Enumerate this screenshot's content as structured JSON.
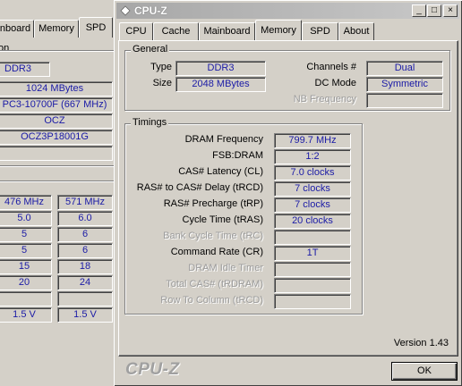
{
  "background_window": {
    "tabs": [
      "nboard",
      "Memory",
      "SPD"
    ],
    "active_tab": "SPD",
    "section_label": "on",
    "module_fields": [
      "DDR3",
      "1024 MBytes",
      "PC3-10700F (667 MHz)",
      "OCZ",
      "OCZ3P18001G",
      ""
    ],
    "timing_columns": [
      [
        "476 MHz",
        "5.0",
        "5",
        "5",
        "15",
        "20",
        "",
        "1.5 V"
      ],
      [
        "571 MHz",
        "6.0",
        "6",
        "6",
        "18",
        "24",
        "",
        "1.5 V"
      ]
    ]
  },
  "window": {
    "title": "CPU-Z",
    "controls": [
      "_",
      "□",
      "×"
    ],
    "tabs": [
      "CPU",
      "Cache",
      "Mainboard",
      "Memory",
      "SPD",
      "About"
    ],
    "active_tab": "Memory"
  },
  "general": {
    "title": "General",
    "type_label": "Type",
    "type_value": "DDR3",
    "size_label": "Size",
    "size_value": "2048 MBytes",
    "channels_label": "Channels #",
    "channels_value": "Dual",
    "dc_mode_label": "DC Mode",
    "dc_mode_value": "Symmetric",
    "nb_freq_label": "NB Frequency",
    "nb_freq_value": ""
  },
  "timings": {
    "title": "Timings",
    "rows": [
      {
        "label": "DRAM Frequency",
        "value": "799.7 MHz",
        "enabled": true
      },
      {
        "label": "FSB:DRAM",
        "value": "1:2",
        "enabled": true
      },
      {
        "label": "CAS# Latency (CL)",
        "value": "7.0 clocks",
        "enabled": true
      },
      {
        "label": "RAS# to CAS# Delay (tRCD)",
        "value": "7 clocks",
        "enabled": true
      },
      {
        "label": "RAS# Precharge (tRP)",
        "value": "7 clocks",
        "enabled": true
      },
      {
        "label": "Cycle Time (tRAS)",
        "value": "20 clocks",
        "enabled": true
      },
      {
        "label": "Bank Cycle Time (tRC)",
        "value": "",
        "enabled": false
      },
      {
        "label": "Command Rate (CR)",
        "value": "1T",
        "enabled": true
      },
      {
        "label": "DRAM Idle Timer",
        "value": "",
        "enabled": false
      },
      {
        "label": "Total CAS# (tRDRAM)",
        "value": "",
        "enabled": false
      },
      {
        "label": "Row To Column (tRCD)",
        "value": "",
        "enabled": false
      }
    ]
  },
  "footer": {
    "version": "Version 1.43",
    "brand": "CPU-Z",
    "ok_label": "OK"
  },
  "colors": {
    "desktop": "#5b79a8",
    "face": "#d4d0c8",
    "value_text": "#1a1aa6",
    "disabled_text": "#9b9b9b"
  }
}
